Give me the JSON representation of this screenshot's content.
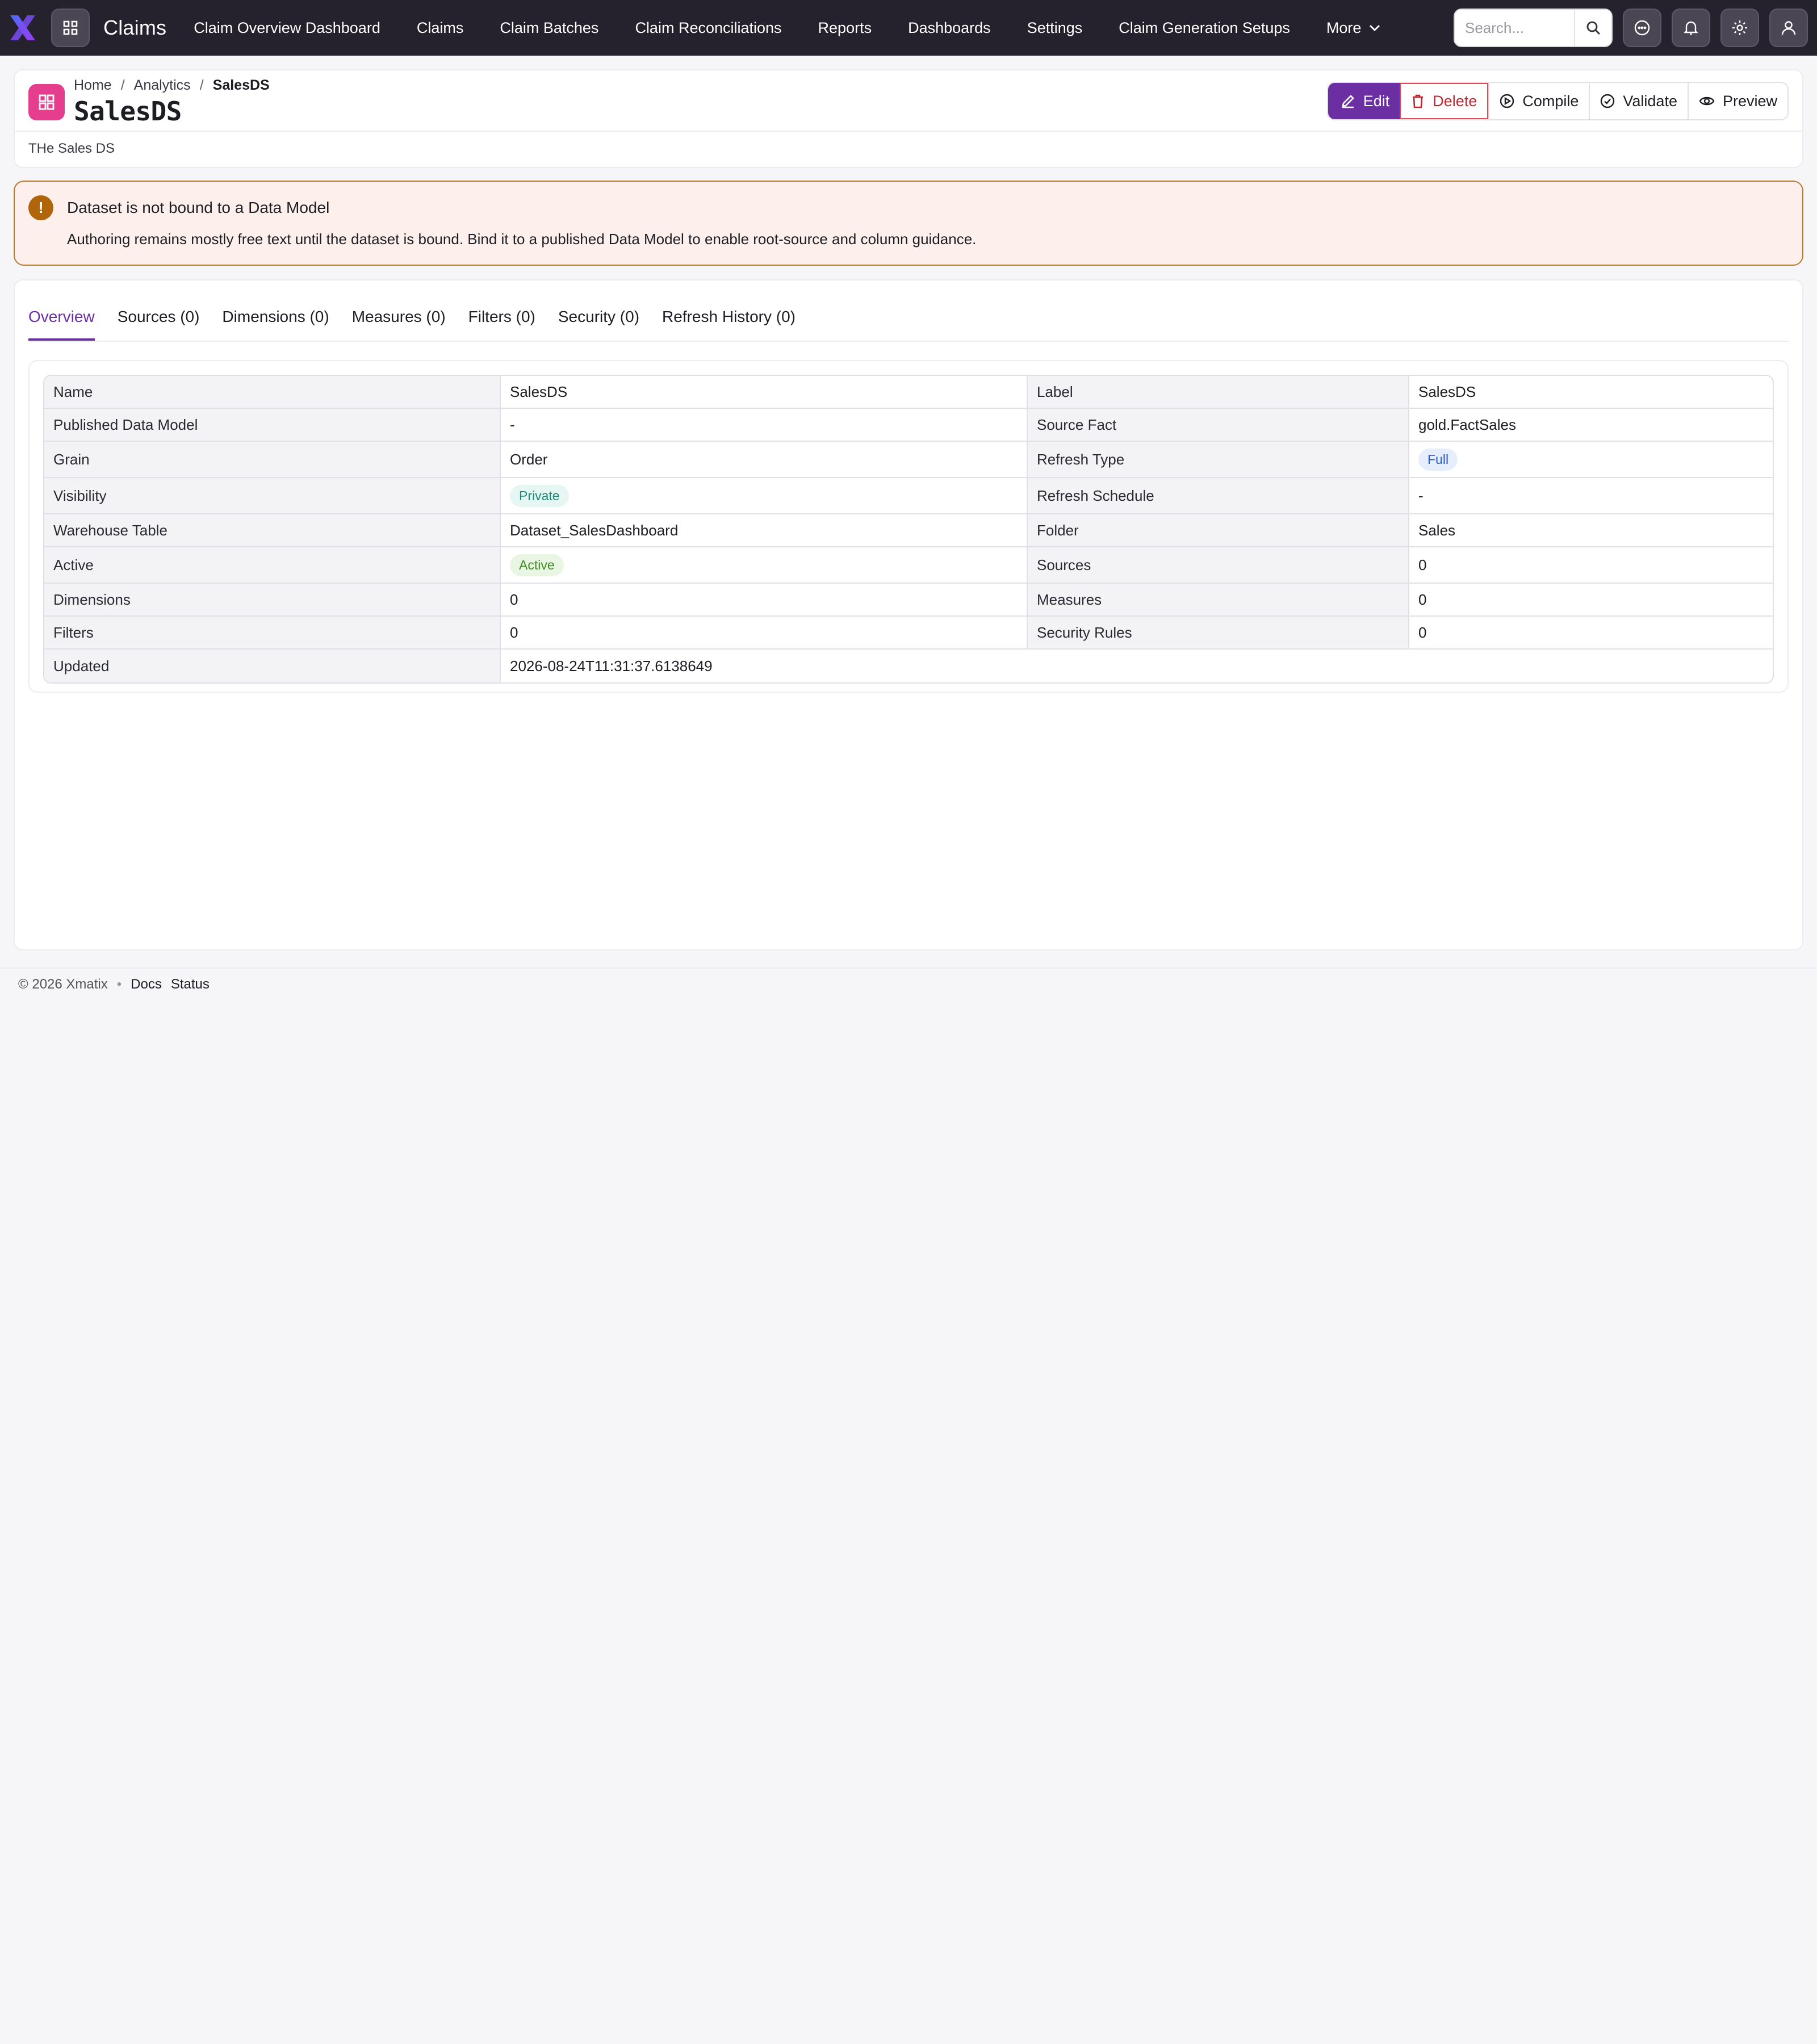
{
  "topbar": {
    "app_name": "Claims",
    "nav": [
      "Claim Overview Dashboard",
      "Claims",
      "Claim Batches",
      "Claim Reconciliations",
      "Reports",
      "Dashboards",
      "Settings",
      "Claim Generation Setups"
    ],
    "more_label": "More",
    "search_placeholder": "Search...",
    "brand_color": "#25222e",
    "accent_color": "#6b2fa3"
  },
  "header": {
    "breadcrumb": [
      "Home",
      "Analytics",
      "SalesDS"
    ],
    "title": "SalesDS",
    "description": "THe Sales DS",
    "actions": {
      "edit": "Edit",
      "delete": "Delete",
      "compile": "Compile",
      "validate": "Validate",
      "preview": "Preview"
    }
  },
  "warning": {
    "title": "Dataset is not bound to a Data Model",
    "body": "Authoring remains mostly free text until the dataset is bound. Bind it to a published Data Model to enable root-source and column guidance."
  },
  "tabs": [
    "Overview",
    "Sources (0)",
    "Dimensions (0)",
    "Measures (0)",
    "Filters (0)",
    "Security (0)",
    "Refresh History (0)"
  ],
  "details": {
    "rows": [
      {
        "k1": "Name",
        "v1": "SalesDS",
        "k2": "Label",
        "v2": "SalesDS"
      },
      {
        "k1": "Published Data Model",
        "v1": "-",
        "k2": "Source Fact",
        "v2": "gold.FactSales"
      },
      {
        "k1": "Grain",
        "v1": "Order",
        "k2": "Refresh Type",
        "v2": "Full"
      },
      {
        "k1": "Visibility",
        "v1": "Private",
        "k2": "Refresh Schedule",
        "v2": "-"
      },
      {
        "k1": "Warehouse Table",
        "v1": "Dataset_SalesDashboard",
        "k2": "Folder",
        "v2": "Sales"
      },
      {
        "k1": "Active",
        "v1": "Active",
        "k2": "Sources",
        "v2": "0"
      },
      {
        "k1": "Dimensions",
        "v1": "0",
        "k2": "Measures",
        "v2": "0"
      },
      {
        "k1": "Filters",
        "v1": "0",
        "k2": "Security Rules",
        "v2": "0"
      },
      {
        "k1": "Updated",
        "v1": "2026-08-24T11:31:37.6138649"
      }
    ]
  },
  "footer": {
    "copyright": "© 2026 Xmatix",
    "links": [
      "Docs",
      "Status"
    ]
  }
}
